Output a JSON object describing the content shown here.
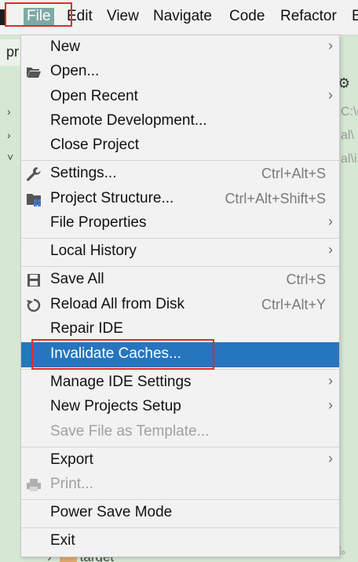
{
  "menubar": {
    "file": "File",
    "edit": "Edit",
    "view": "View",
    "navigate": "Navigate",
    "code": "Code",
    "refactor": "Refactor",
    "build_fragment": "B"
  },
  "background": {
    "tab_fragment": "pr",
    "right_fragments": [
      "C:\\d",
      "al\\",
      "al\\i"
    ],
    "tree_item": "target",
    "watermark": "CSDN @待续。"
  },
  "file_menu": {
    "new": "New",
    "open": "Open...",
    "open_recent": "Open Recent",
    "remote_development": "Remote Development...",
    "close_project": "Close Project",
    "settings": "Settings...",
    "settings_shortcut": "Ctrl+Alt+S",
    "project_structure": "Project Structure...",
    "project_structure_shortcut": "Ctrl+Alt+Shift+S",
    "file_properties": "File Properties",
    "local_history": "Local History",
    "save_all": "Save All",
    "save_all_shortcut": "Ctrl+S",
    "reload_all": "Reload All from Disk",
    "reload_all_shortcut": "Ctrl+Alt+Y",
    "repair_ide": "Repair IDE",
    "invalidate_caches": "Invalidate Caches...",
    "manage_ide_settings": "Manage IDE Settings",
    "new_projects_setup": "New Projects Setup",
    "save_file_as_template": "Save File as Template...",
    "export": "Export",
    "print": "Print...",
    "power_save_mode": "Power Save Mode",
    "exit": "Exit"
  },
  "colors": {
    "selection": "#2675bf",
    "annotation_box": "#e02a2a",
    "menu_background": "#f2f2f2",
    "ide_background": "#d5e8d4"
  },
  "icons": [
    "folder-open-icon",
    "wrench-icon",
    "project-structure-icon",
    "save-icon",
    "reload-icon",
    "print-icon",
    "chevron-right-icon"
  ]
}
